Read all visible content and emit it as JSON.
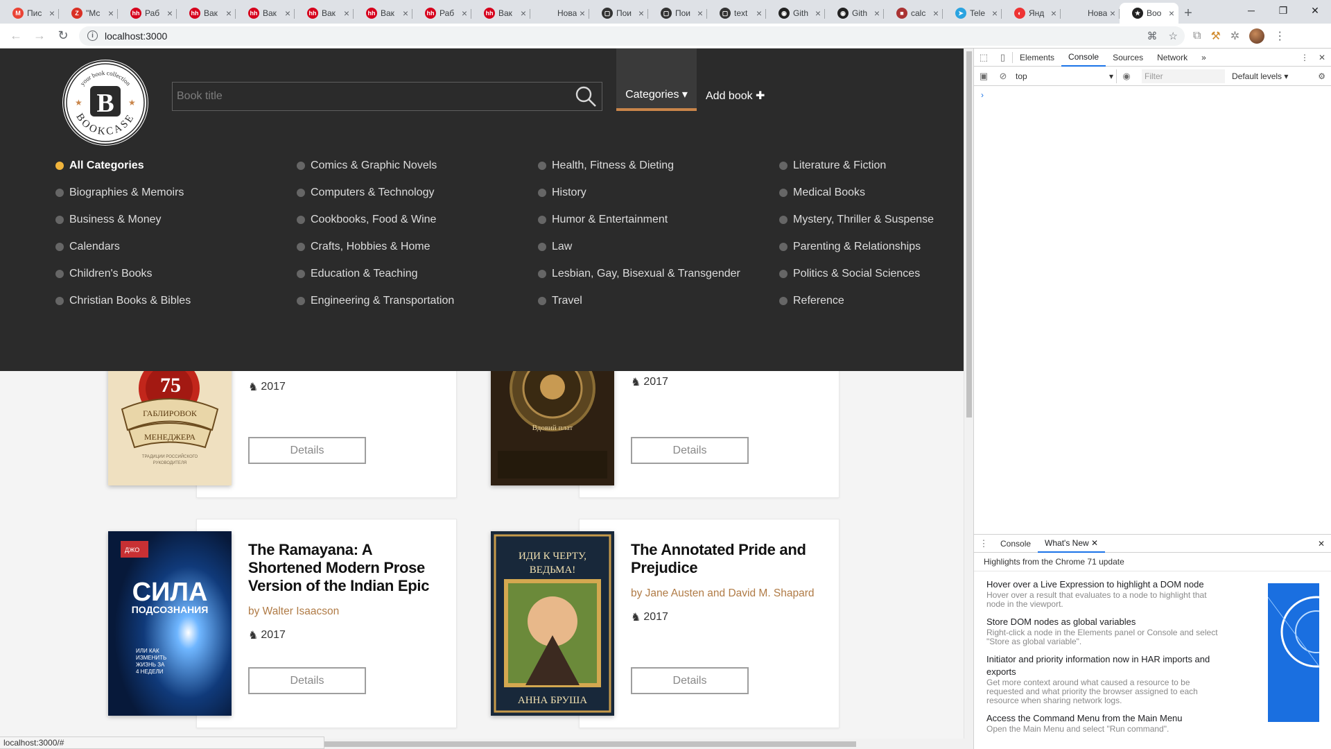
{
  "browser": {
    "tabs": [
      {
        "title": "Пис",
        "color": "#ea4335",
        "glyph": "M"
      },
      {
        "title": "\"Мс",
        "color": "#d93025",
        "glyph": "Z"
      },
      {
        "title": "Раб",
        "color": "#d6001c",
        "glyph": "hh"
      },
      {
        "title": "Вак",
        "color": "#d6001c",
        "glyph": "hh"
      },
      {
        "title": "Вак",
        "color": "#d6001c",
        "glyph": "hh"
      },
      {
        "title": "Вак",
        "color": "#d6001c",
        "glyph": "hh"
      },
      {
        "title": "Вак",
        "color": "#d6001c",
        "glyph": "hh"
      },
      {
        "title": "Раб",
        "color": "#d6001c",
        "glyph": "hh"
      },
      {
        "title": "Вак",
        "color": "#d6001c",
        "glyph": "hh"
      },
      {
        "title": "Новая в",
        "color": "",
        "glyph": ""
      },
      {
        "title": "Пои",
        "color": "#333",
        "glyph": "▢"
      },
      {
        "title": "Пои",
        "color": "#333",
        "glyph": "▢"
      },
      {
        "title": "text",
        "color": "#333",
        "glyph": "▢"
      },
      {
        "title": "Gith",
        "color": "#222",
        "glyph": "◉"
      },
      {
        "title": "Gith",
        "color": "#222",
        "glyph": "◉"
      },
      {
        "title": "calc",
        "color": "#a33",
        "glyph": "■"
      },
      {
        "title": "Tele",
        "color": "#2aa3e0",
        "glyph": "➤"
      },
      {
        "title": "Янд",
        "color": "#e33",
        "glyph": "◐"
      },
      {
        "title": "Новая в",
        "color": "",
        "glyph": ""
      },
      {
        "title": "Boo",
        "color": "#222",
        "glyph": "★",
        "active": true
      }
    ],
    "url": "localhost:3000",
    "status_url": "localhost:3000/#"
  },
  "header": {
    "logo": {
      "top_text": "your book collection",
      "bottom_text": "BOOKCASE",
      "letter": "B"
    },
    "search_placeholder": "Book title",
    "categories_label": "Categories ▾",
    "add_book_label": "Add book ✚"
  },
  "categories": [
    [
      "All Categories",
      "Biographies & Memoirs",
      "Business & Money",
      "Calendars",
      "Children's Books",
      "Christian Books & Bibles"
    ],
    [
      "Comics & Graphic Novels",
      "Computers & Technology",
      "Cookbooks, Food & Wine",
      "Crafts, Hobbies & Home",
      "Education & Teaching",
      "Engineering & Transportation"
    ],
    [
      "Health, Fitness & Dieting",
      "History",
      "Humor & Entertainment",
      "Law",
      "Lesbian, Gay, Bisexual & Transgender",
      "Travel"
    ],
    [
      "Literature & Fiction",
      "Medical Books",
      "Mystery, Thriller & Suspense",
      "Parenting & Relationships",
      "Politics & Social Sciences",
      "Reference"
    ]
  ],
  "active_category": "All Categories",
  "books": [
    {
      "title": "",
      "author": "",
      "year": "2017",
      "details": "Details",
      "cover_text": "75 ГАБЛИРОВОК МЕНЕДЖЕРА"
    },
    {
      "title": "",
      "author": "",
      "year": "2017",
      "details": "Details",
      "cover_text": "Вдовий плат"
    },
    {
      "title": "The Ramayana: A Shortened Modern Prose Version of the Indian Epic",
      "author": "by Walter Isaacson",
      "year": "2017",
      "details": "Details",
      "cover_text": "СИЛА ПОДСОЗНАНИЯ"
    },
    {
      "title": "The Annotated Pride and Prejudice",
      "author": "by Jane Austen and David M. Shapard",
      "year": "2017",
      "details": "Details",
      "cover_text": "ИДИ К ЧЕРТУ, ВЕДЬМА!",
      "cover_author": "АННА БРУША"
    }
  ],
  "devtools": {
    "tabs": [
      "Elements",
      "Console",
      "Sources",
      "Network",
      "»"
    ],
    "selected_tab": "Console",
    "context": "top",
    "filter_placeholder": "Filter",
    "levels": "Default levels ▾",
    "drawer_tabs": [
      "Console",
      "What's New"
    ],
    "whats_new_subtitle": "Highlights from the Chrome 71 update",
    "items": [
      {
        "title": "Hover over a Live Expression to highlight a DOM node",
        "desc": "Hover over a result that evaluates to a node to highlight that node in the viewport."
      },
      {
        "title": "Store DOM nodes as global variables",
        "desc": "Right-click a node in the Elements panel or Console and select \"Store as global variable\"."
      },
      {
        "title": "Initiator and priority information now in HAR imports and exports",
        "desc": "Get more context around what caused a resource to be requested and what priority the browser assigned to each resource when sharing network logs."
      },
      {
        "title": "Access the Command Menu from the Main Menu",
        "desc": "Open the Main Menu and select \"Run command\"."
      }
    ]
  },
  "colors": {
    "header_bg": "#2b2b2b",
    "accent": "#c9854a",
    "author": "#b07b46",
    "active_dot": "#f0b43c"
  }
}
